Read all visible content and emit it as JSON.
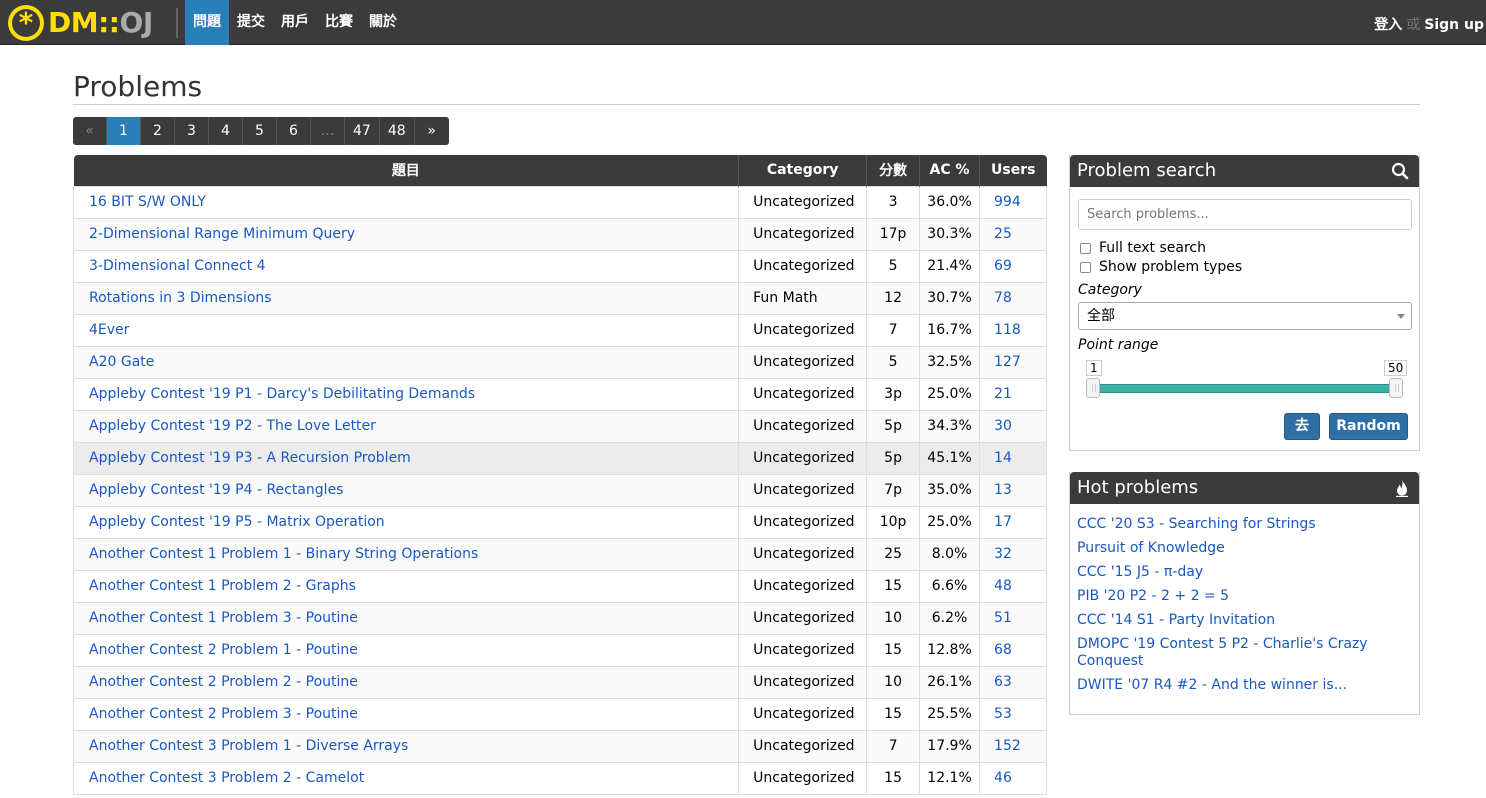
{
  "nav": {
    "logo_dm": "DM",
    "logo_sep": "::",
    "logo_oj": "OJ",
    "items": [
      {
        "label": "問題",
        "active": true
      },
      {
        "label": "提交",
        "active": false
      },
      {
        "label": "用戶",
        "active": false
      },
      {
        "label": "比賽",
        "active": false
      },
      {
        "label": "關於",
        "active": false
      }
    ],
    "login": "登入",
    "or": "或",
    "signup": "Sign up"
  },
  "page": {
    "title": "Problems"
  },
  "pagination": [
    "«",
    "1",
    "2",
    "3",
    "4",
    "5",
    "6",
    "…",
    "47",
    "48",
    "»"
  ],
  "table": {
    "headers": [
      "題目",
      "Category",
      "分數",
      "AC %",
      "Users"
    ],
    "rows": [
      {
        "name": "16 BIT S/W ONLY",
        "category": "Uncategorized",
        "points": "3",
        "ac": "36.0%",
        "users": "994"
      },
      {
        "name": "2-Dimensional Range Minimum Query",
        "category": "Uncategorized",
        "points": "17p",
        "ac": "30.3%",
        "users": "25"
      },
      {
        "name": "3-Dimensional Connect 4",
        "category": "Uncategorized",
        "points": "5",
        "ac": "21.4%",
        "users": "69"
      },
      {
        "name": "Rotations in 3 Dimensions",
        "category": "Fun Math",
        "points": "12",
        "ac": "30.7%",
        "users": "78"
      },
      {
        "name": "4Ever",
        "category": "Uncategorized",
        "points": "7",
        "ac": "16.7%",
        "users": "118"
      },
      {
        "name": "A20 Gate",
        "category": "Uncategorized",
        "points": "5",
        "ac": "32.5%",
        "users": "127"
      },
      {
        "name": "Appleby Contest '19 P1 - Darcy's Debilitating Demands",
        "category": "Uncategorized",
        "points": "3p",
        "ac": "25.0%",
        "users": "21"
      },
      {
        "name": "Appleby Contest '19 P2 - The Love Letter",
        "category": "Uncategorized",
        "points": "5p",
        "ac": "34.3%",
        "users": "30"
      },
      {
        "name": "Appleby Contest '19 P3 - A Recursion Problem",
        "category": "Uncategorized",
        "points": "5p",
        "ac": "45.1%",
        "users": "14"
      },
      {
        "name": "Appleby Contest '19 P4 - Rectangles",
        "category": "Uncategorized",
        "points": "7p",
        "ac": "35.0%",
        "users": "13"
      },
      {
        "name": "Appleby Contest '19 P5 - Matrix Operation",
        "category": "Uncategorized",
        "points": "10p",
        "ac": "25.0%",
        "users": "17"
      },
      {
        "name": "Another Contest 1 Problem 1 - Binary String Operations",
        "category": "Uncategorized",
        "points": "25",
        "ac": "8.0%",
        "users": "32"
      },
      {
        "name": "Another Contest 1 Problem 2 - Graphs",
        "category": "Uncategorized",
        "points": "15",
        "ac": "6.6%",
        "users": "48"
      },
      {
        "name": "Another Contest 1 Problem 3 - Poutine",
        "category": "Uncategorized",
        "points": "10",
        "ac": "6.2%",
        "users": "51"
      },
      {
        "name": "Another Contest 2 Problem 1 - Poutine",
        "category": "Uncategorized",
        "points": "15",
        "ac": "12.8%",
        "users": "68"
      },
      {
        "name": "Another Contest 2 Problem 2 - Poutine",
        "category": "Uncategorized",
        "points": "10",
        "ac": "26.1%",
        "users": "63"
      },
      {
        "name": "Another Contest 2 Problem 3 - Poutine",
        "category": "Uncategorized",
        "points": "15",
        "ac": "25.5%",
        "users": "53"
      },
      {
        "name": "Another Contest 3 Problem 1 - Diverse Arrays",
        "category": "Uncategorized",
        "points": "7",
        "ac": "17.9%",
        "users": "152"
      },
      {
        "name": "Another Contest 3 Problem 2 - Camelot",
        "category": "Uncategorized",
        "points": "15",
        "ac": "12.1%",
        "users": "46"
      }
    ]
  },
  "search": {
    "title": "Problem search",
    "icon": "search-icon",
    "placeholder": "Search problems...",
    "full_text": "Full text search",
    "show_types": "Show problem types",
    "category_label": "Category",
    "category_value": "全部",
    "point_range_label": "Point range",
    "range_min": "1",
    "range_max": "50",
    "go_button": "去",
    "random_button": "Random"
  },
  "hot": {
    "title": "Hot problems",
    "icon": "fire-icon",
    "items": [
      "CCC '20 S3 - Searching for Strings",
      "Pursuit of Knowledge",
      "CCC '15 J5 - π-day",
      "PIB '20 P2 - 2 + 2 = 5",
      "CCC '14 S1 - Party Invitation",
      "DMOPC '19 Contest 5 P2 - Charlie's Crazy Conquest",
      "DWITE '07 R4 #2 - And the winner is..."
    ]
  },
  "colors": {
    "accent": "#2980b9",
    "nav_bg": "#3b3b3b",
    "link": "#1958c1",
    "logo": "#ffde05",
    "slider": "#3ab0a7"
  }
}
